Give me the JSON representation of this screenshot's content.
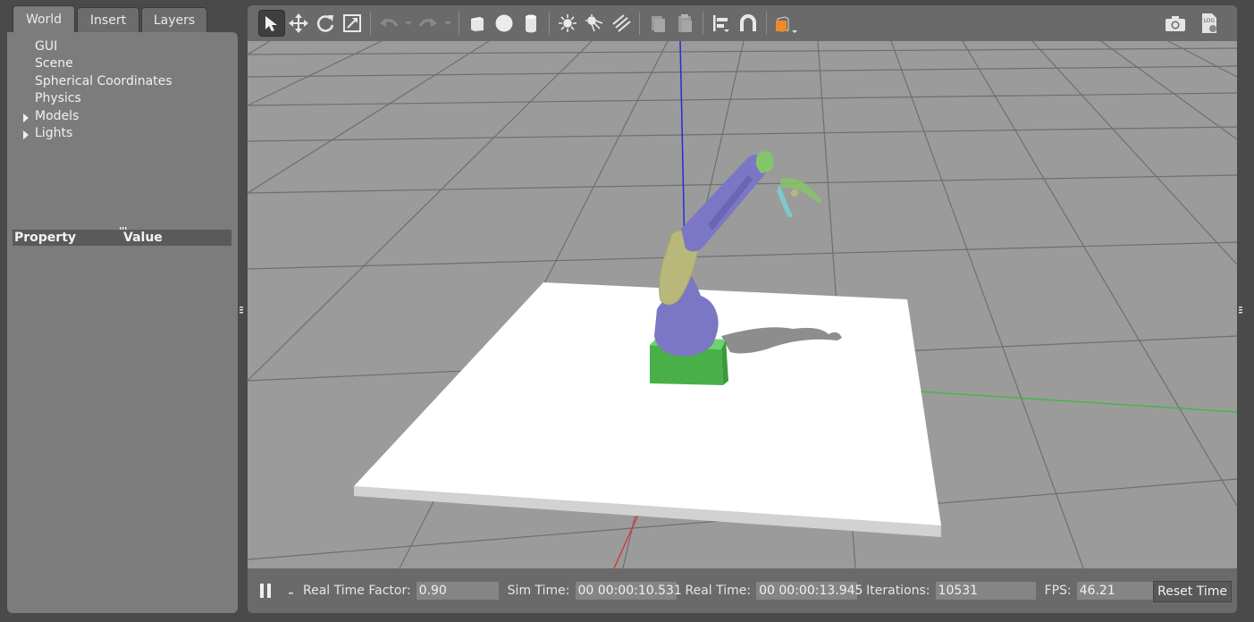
{
  "tabs": [
    {
      "label": "World",
      "active": true
    },
    {
      "label": "Insert",
      "active": false
    },
    {
      "label": "Layers",
      "active": false
    }
  ],
  "tree": [
    {
      "label": "GUI",
      "expandable": false
    },
    {
      "label": "Scene",
      "expandable": false
    },
    {
      "label": "Spherical Coordinates",
      "expandable": false
    },
    {
      "label": "Physics",
      "expandable": false
    },
    {
      "label": "Models",
      "expandable": true
    },
    {
      "label": "Lights",
      "expandable": true
    }
  ],
  "properties": {
    "col_property": "Property",
    "col_value": "Value"
  },
  "toolbar": {
    "tools": [
      "select-arrow-icon",
      "translate-icon",
      "rotate-icon",
      "scale-icon"
    ],
    "active_tool": "select-arrow-icon"
  },
  "bottom": {
    "rtf_label": "Real Time Factor:",
    "rtf_value": "0.90",
    "sim_label": "Sim Time:",
    "sim_value": "00 00:00:10.531",
    "real_label": "Real Time:",
    "real_value": "00 00:00:13.945",
    "iter_label": "Iterations:",
    "iter_value": "10531",
    "fps_label": "FPS:",
    "fps_value": "46.21",
    "reset_label": "Reset Time"
  },
  "colors": {
    "robot_purple": "#7b77c4",
    "robot_yellow": "#b8b87a",
    "base_green": "#5dc45d",
    "gripper_green": "#86c46a",
    "axis_z": "#2a2ad8",
    "axis_x": "#d83030",
    "axis_y": "#3ab83a",
    "orange_cube": "#f08a24"
  }
}
